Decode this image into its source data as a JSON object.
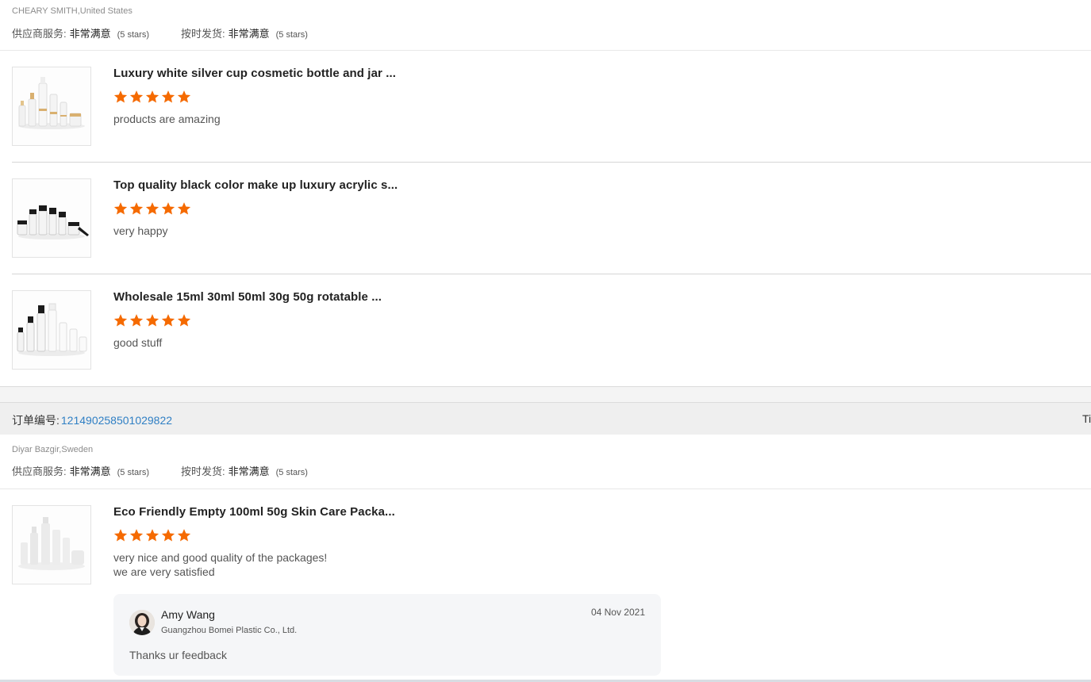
{
  "reviews": [
    {
      "buyer": "CHEARY SMITH,United States",
      "supplier_service_label": "供应商服务:",
      "supplier_service_value": "非常满意",
      "supplier_service_stars": "(5 stars)",
      "shipment_label": "按时发货:",
      "shipment_value": "非常满意",
      "shipment_stars": "(5 stars)",
      "products": [
        {
          "title": "Luxury white silver cup cosmetic bottle and jar ...",
          "rating": 5,
          "comment": "products are amazing",
          "thumb_icon": "white-cosmetic-bottles-image"
        },
        {
          "title": "Top quality black color make up luxury acrylic s...",
          "rating": 5,
          "comment": "very happy",
          "thumb_icon": "black-cap-bottles-image"
        },
        {
          "title": "Wholesale 15ml 30ml 50ml 30g 50g rotatable ...",
          "rating": 5,
          "comment": "good stuff",
          "thumb_icon": "rotatable-bottles-image"
        }
      ]
    },
    {
      "order_label": "订单编号:",
      "order_number": "121490258501029822",
      "order_right_text": "Ti",
      "buyer": "Diyar Bazgir,Sweden",
      "supplier_service_label": "供应商服务:",
      "supplier_service_value": "非常满意",
      "supplier_service_stars": "(5 stars)",
      "shipment_label": "按时发货:",
      "shipment_value": "非常满意",
      "shipment_stars": "(5 stars)",
      "products": [
        {
          "title": "Eco Friendly Empty 100ml 50g Skin Care Packa...",
          "rating": 5,
          "comment": "very nice and good quality of the packages!\nwe are very satisfied",
          "thumb_icon": "frosted-bottles-image"
        }
      ],
      "reply": {
        "name": "Amy Wang",
        "company": "Guangzhou Bomei Plastic Co., Ltd.",
        "date": "04 Nov 2021",
        "text": "Thanks ur feedback",
        "avatar_icon": "person-avatar"
      }
    }
  ],
  "colors": {
    "star": "#f56a00",
    "order_link": "#2f7fc4",
    "order_bar_bg": "#efefef",
    "reply_bg": "#f5f6f8"
  }
}
